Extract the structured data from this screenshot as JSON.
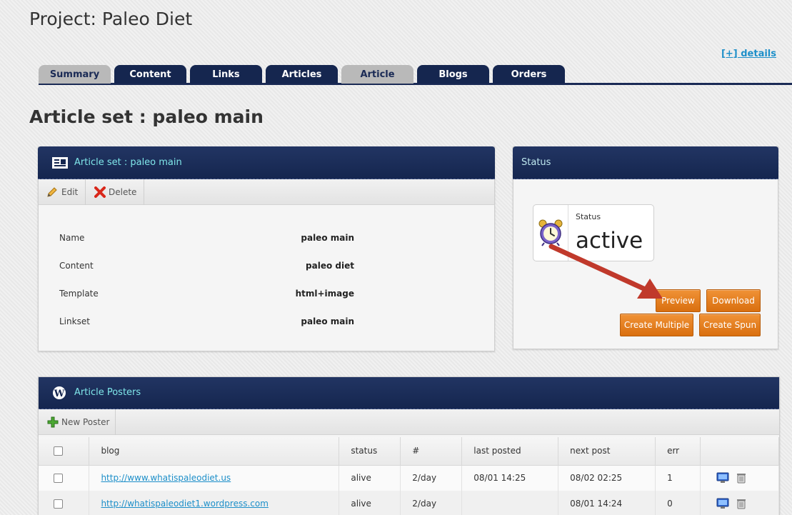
{
  "page_title": "Project: Paleo Diet",
  "details_link": "[+] details",
  "tabs": [
    {
      "label": "Summary",
      "style": "light"
    },
    {
      "label": "Content",
      "style": "dark"
    },
    {
      "label": "Links",
      "style": "dark"
    },
    {
      "label": "Articles",
      "style": "dark"
    },
    {
      "label": "Article",
      "style": "light"
    },
    {
      "label": "Blogs",
      "style": "dark"
    },
    {
      "label": "Orders",
      "style": "dark"
    }
  ],
  "section_title": "Article set : paleo main",
  "article_panel": {
    "title": "Article set : paleo main",
    "edit_label": "Edit",
    "delete_label": "Delete",
    "fields": [
      {
        "key": "Name",
        "value": "paleo main"
      },
      {
        "key": "Content",
        "value": "paleo diet"
      },
      {
        "key": "Template",
        "value": "html+image"
      },
      {
        "key": "Linkset",
        "value": "paleo main"
      }
    ]
  },
  "status_panel": {
    "title": "Status",
    "card_label": "Status",
    "card_value": "active",
    "buttons": {
      "preview": "Preview",
      "download": "Download",
      "create_multiple": "Create Multiple",
      "create_spun": "Create Spun"
    }
  },
  "posters_panel": {
    "title": "Article Posters",
    "new_poster_label": "New Poster",
    "columns": [
      "blog",
      "status",
      "#",
      "last posted",
      "next post",
      "err"
    ],
    "rows": [
      {
        "blog": "http://www.whatispaleodiet.us",
        "status": "alive",
        "rate": "2/day",
        "last_posted": "08/01 14:25",
        "next_post": "08/02 02:25",
        "err": "1"
      },
      {
        "blog": "http://whatispaleodiet1.wordpress.com",
        "status": "alive",
        "rate": "2/day",
        "last_posted": "",
        "next_post": "08/01 14:24",
        "err": "0"
      }
    ]
  },
  "colors": {
    "navy": "#15264f",
    "accent_cyan": "#7fe6e9",
    "orange": "#e07a1c",
    "link": "#1d8fc9",
    "arrow": "#c0392b"
  }
}
